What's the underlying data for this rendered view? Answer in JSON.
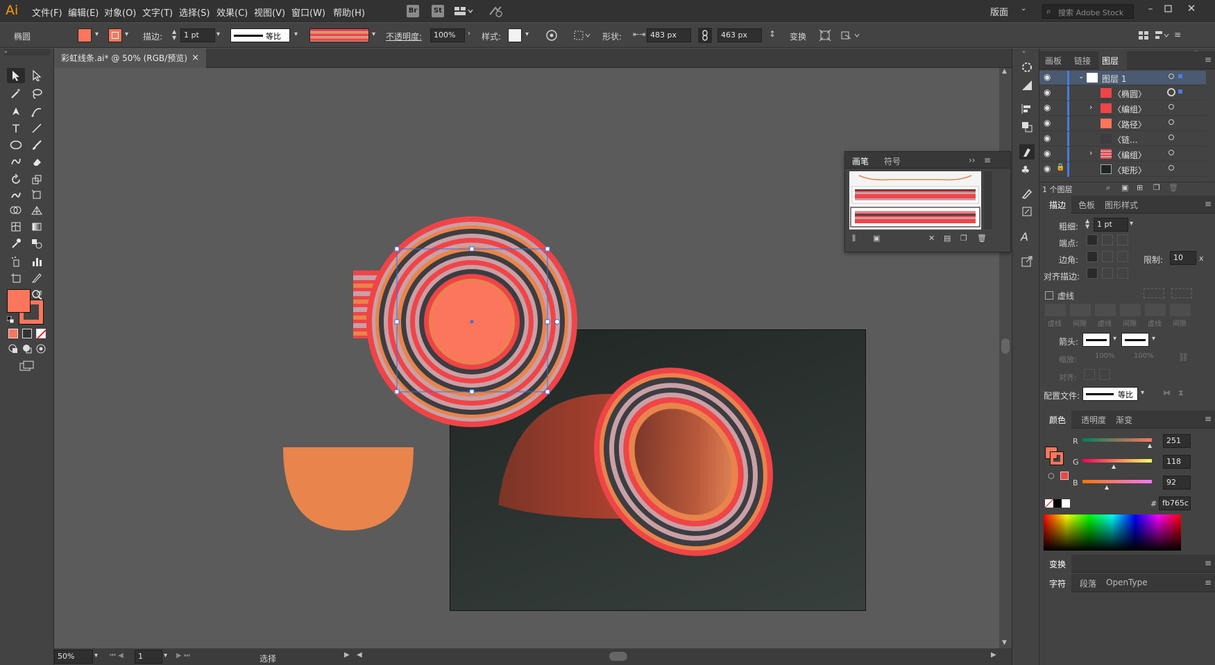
{
  "app": {
    "logo": "Ai"
  },
  "menu": [
    "文件(F)",
    "编辑(E)",
    "对象(O)",
    "文字(T)",
    "选择(S)",
    "效果(C)",
    "视图(V)",
    "窗口(W)",
    "帮助(H)"
  ],
  "menu_badges": [
    "Br",
    "St"
  ],
  "workspace": {
    "label": "版面",
    "search_placeholder": "搜索 Adobe Stock"
  },
  "control": {
    "object_type": "椭圆",
    "stroke_label": "描边:",
    "stroke_weight": "1 pt",
    "stroke_profile": "等比",
    "opacity_label": "不透明度:",
    "opacity_value": "100%",
    "style_label": "样式:",
    "shape_label": "形状:",
    "width_value": "483 px",
    "height_value": "463 px",
    "transform_label": "变换"
  },
  "document_tab": {
    "title": "彩虹线条.ai* @ 50% (RGB/预览)",
    "close": "×"
  },
  "status": {
    "zoom": "50%",
    "artboard_num": "1",
    "tool_name": "选择"
  },
  "brush_panel": {
    "tabs": [
      "画笔",
      "符号"
    ],
    "more": "››"
  },
  "layers_panel": {
    "tabs": [
      "画板",
      "链接",
      "图层"
    ],
    "active_tab": "图层",
    "layer_name": "图层 1",
    "items": [
      "〈椭圆〉",
      "〈编组〉",
      "〈路径〉",
      "〈链...",
      "〈编组〉",
      "〈矩形〉"
    ],
    "footer": "1 个图层"
  },
  "stroke_panel": {
    "tabs": [
      "描边",
      "色板",
      "图形样式"
    ],
    "weight_label": "粗细:",
    "weight_value": "1 pt",
    "cap_label": "端点:",
    "corner_label": "边角:",
    "limit_label": "限制:",
    "limit_value": "10",
    "limit_unit": "x",
    "align_label": "对齐描边:",
    "dashed_label": "虚线",
    "dash_labels": [
      "虚线",
      "间隙",
      "虚线",
      "间隙",
      "虚线",
      "间隙"
    ],
    "arrow_label": "箭头:",
    "scale_label": "缩放:",
    "scale_values": [
      "100%",
      "100%"
    ],
    "align_arrow_label": "对齐:",
    "profile_label": "配置文件:",
    "profile_value": "等比"
  },
  "color_panel": {
    "tabs": [
      "颜色",
      "透明度",
      "渐变"
    ],
    "r_label": "R",
    "r_value": "251",
    "g_label": "G",
    "g_value": "118",
    "b_label": "B",
    "b_value": "92",
    "hex_label": "#",
    "hex_value": "fb765c"
  },
  "transform_panel": {
    "label": "变换"
  },
  "char_panel": {
    "tabs": [
      "字符",
      "段落",
      "OpenType"
    ]
  },
  "colors": {
    "fill": "#fb765c",
    "accent_red": "#f04447",
    "stripe_gray": "#c9a0a6",
    "stripe_dark": "#3c3d41",
    "stripe_orange": "#e8844c",
    "selection": "#3d6fdc",
    "artboard_dark": "#1f2624"
  }
}
